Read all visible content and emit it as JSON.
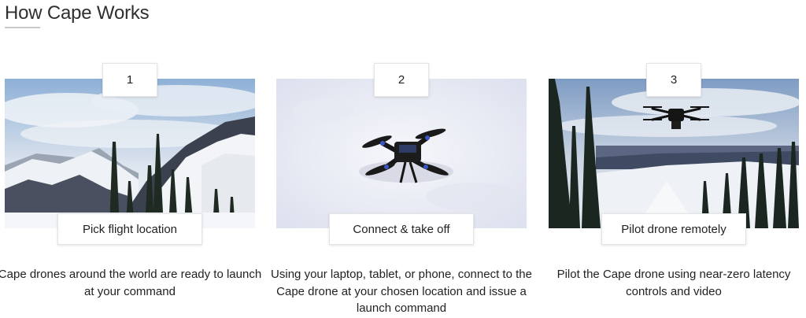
{
  "section": {
    "title": "How Cape Works"
  },
  "steps": [
    {
      "number": "1",
      "label": "Pick flight location",
      "description": "Cape drones around the world are ready to launch at your command"
    },
    {
      "number": "2",
      "label": "Connect & take off",
      "description": "Using your laptop, tablet, or phone, connect to the Cape drone at your chosen location and issue a launch command"
    },
    {
      "number": "3",
      "label": "Pilot drone remotely",
      "description": "Pilot the Cape drone using near-zero latency controls and video"
    }
  ]
}
